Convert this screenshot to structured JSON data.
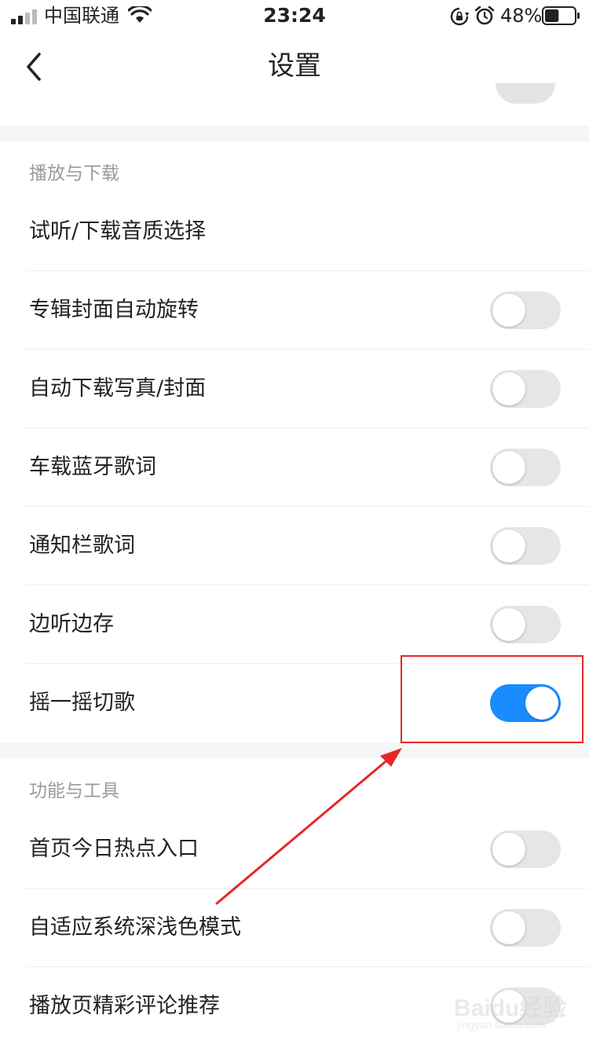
{
  "status_bar": {
    "carrier": "中国联通",
    "time": "23:24",
    "battery_percent": "48%",
    "battery_level": 0.48,
    "icons": [
      "signal-icon",
      "wifi-icon",
      "rotation-lock-icon",
      "alarm-icon",
      "battery-icon"
    ]
  },
  "nav": {
    "title": "设置",
    "back_icon": "chevron-left-icon"
  },
  "sections": [
    {
      "title": "播放与下载",
      "items": [
        {
          "label": "试听/下载音质选择",
          "has_toggle": false
        },
        {
          "label": "专辑封面自动旋转",
          "toggle_on": false
        },
        {
          "label": "自动下载写真/封面",
          "toggle_on": false
        },
        {
          "label": "车载蓝牙歌词",
          "toggle_on": false
        },
        {
          "label": "通知栏歌词",
          "toggle_on": false
        },
        {
          "label": "边听边存",
          "toggle_on": false
        },
        {
          "label": "摇一摇切歌",
          "toggle_on": true
        }
      ]
    },
    {
      "title": "功能与工具",
      "items": [
        {
          "label": "首页今日热点入口",
          "toggle_on": false
        },
        {
          "label": "自适应系统深浅色模式",
          "toggle_on": false
        },
        {
          "label": "播放页精彩评论推荐",
          "toggle_on": false
        }
      ]
    }
  ],
  "watermark": {
    "brand": "Baidu经验",
    "url": "jingyan.baidu.com"
  },
  "colors": {
    "toggle_on": "#1a8cff",
    "toggle_off": "#e6e6e6",
    "annotation": "#e52727",
    "section_title": "#9a9a9a"
  }
}
